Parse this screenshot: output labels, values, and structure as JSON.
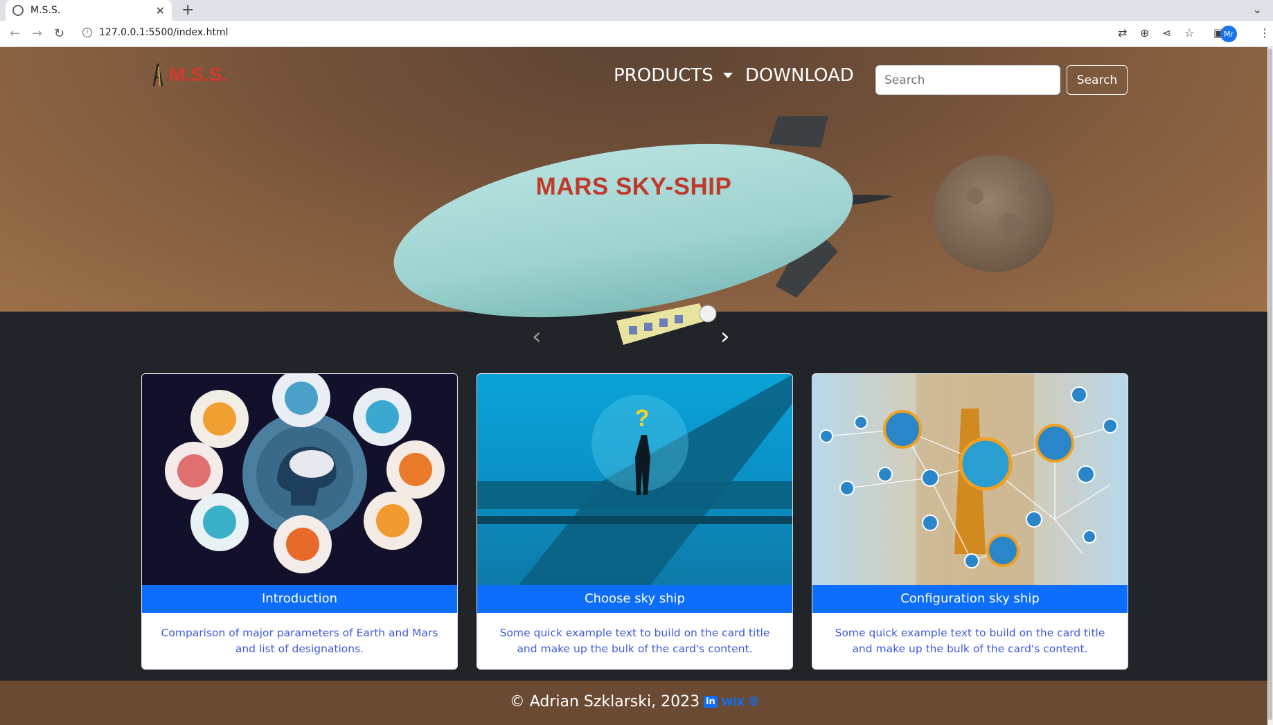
{
  "browser": {
    "tab_title": "M.S.S.",
    "tab_close": "✕",
    "new_tab": "+",
    "url": "127.0.0.1:5500/index.html",
    "profile_initials": "Mr"
  },
  "navbar": {
    "brand": "M.S.S.",
    "products": "PRODUCTS",
    "download": "DOWNLOAD",
    "search_placeholder": "Search",
    "search_button": "Search"
  },
  "hero": {
    "title": "MARS SKY-SHIP",
    "prev": "‹",
    "next": "›"
  },
  "cards": [
    {
      "title": "Introduction",
      "text": "Comparison of major parameters of Earth and Mars and list of designations."
    },
    {
      "title": "Choose sky ship",
      "text": "Some quick example text to build on the card title and make up the bulk of the card's content."
    },
    {
      "title": "Configuration sky ship",
      "text": "Some quick example text to build on the card title and make up the bulk of the card's content."
    }
  ],
  "footer": {
    "copyright": "© Adrian Szklarski, 2023",
    "linkedin": "in",
    "wix": "WiX",
    "github": "⌾"
  },
  "colors": {
    "brand_red": "#d43a2a",
    "primary_blue": "#0d6efd",
    "hero_brown": "#8a6242",
    "footer_brown": "#6b4a34",
    "dark_bg": "#212529"
  },
  "icons": [
    "back-icon",
    "forward-icon",
    "reload-icon",
    "info-icon",
    "translate-icon",
    "zoom-icon",
    "share-icon",
    "star-icon",
    "sidepanel-icon",
    "menu-icon"
  ]
}
